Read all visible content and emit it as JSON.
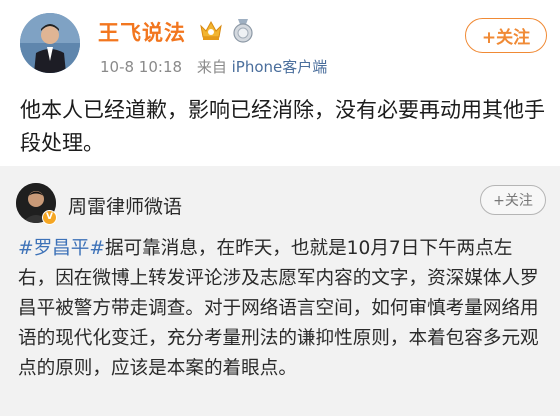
{
  "post": {
    "author": "王飞说法",
    "date": "10-8 10:18",
    "source_prefix": "来自",
    "source": "iPhone客户端",
    "follow_label": "+关注",
    "text": "他本人已经道歉，影响已经消除，没有必要再动用其他手段处理。"
  },
  "repost": {
    "author": "周雷律师微语",
    "follow_label": "+关注",
    "topic": "#罗昌平#",
    "text": "据可靠消息，在昨天，也就是10月7日下午两点左右，因在微博上转发评论涉及志愿军内容的文字，资深媒体人罗昌平被警方带走调查。对于网络语言空间，如何审慎考量网络用语的现代化变迁，充分考量刑法的谦抑性原则，本着包容多元观点的原则，应该是本案的着眼点。"
  },
  "icons": [
    "crown-badge-icon",
    "medal-badge-icon",
    "verified-v-icon"
  ],
  "colors": {
    "author_name": "#f2761f",
    "topic": "#3d72b8",
    "follow": "#f08a35",
    "repost_bg": "#f2f2f2"
  }
}
